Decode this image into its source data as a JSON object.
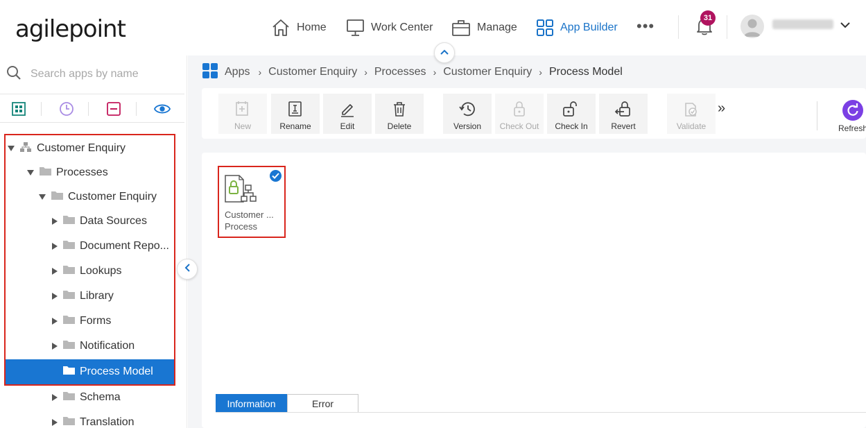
{
  "header": {
    "logo": "agilepoint",
    "nav": [
      {
        "label": "Home",
        "icon": "home-icon"
      },
      {
        "label": "Work Center",
        "icon": "monitor-icon"
      },
      {
        "label": "Manage",
        "icon": "briefcase-icon"
      },
      {
        "label": "App Builder",
        "icon": "app-grid-icon",
        "active": true
      }
    ],
    "more": "•••",
    "notification_count": "31"
  },
  "sidebar": {
    "search_placeholder": "Search apps by name",
    "tree": [
      {
        "label": "Customer Enquiry",
        "level": 0,
        "expanded": true,
        "icon": "sitemap-icon"
      },
      {
        "label": "Processes",
        "level": 1,
        "expanded": true,
        "icon": "folder-icon"
      },
      {
        "label": "Customer Enquiry",
        "level": 2,
        "expanded": true,
        "icon": "folder-icon"
      },
      {
        "label": "Data Sources",
        "level": 3,
        "expanded": false,
        "icon": "folder-icon"
      },
      {
        "label": "Document Repo...",
        "level": 3,
        "expanded": false,
        "icon": "folder-icon"
      },
      {
        "label": "Lookups",
        "level": 3,
        "expanded": false,
        "icon": "folder-icon"
      },
      {
        "label": "Library",
        "level": 3,
        "expanded": false,
        "icon": "folder-icon"
      },
      {
        "label": "Forms",
        "level": 3,
        "expanded": false,
        "icon": "folder-icon"
      },
      {
        "label": "Notification",
        "level": 3,
        "expanded": false,
        "icon": "folder-icon"
      },
      {
        "label": "Process Model",
        "level": 3,
        "selected": true,
        "icon": "folder-icon"
      },
      {
        "label": "Schema",
        "level": 3,
        "expanded": false,
        "icon": "folder-icon"
      },
      {
        "label": "Translation",
        "level": 3,
        "expanded": false,
        "icon": "folder-icon"
      }
    ]
  },
  "breadcrumb": {
    "items": [
      "Apps",
      "Customer Enquiry",
      "Processes",
      "Customer Enquiry",
      "Process Model"
    ],
    "separator": "›"
  },
  "toolbar": {
    "new": "New",
    "rename": "Rename",
    "edit": "Edit",
    "delete": "Delete",
    "version": "Version",
    "check_out": "Check Out",
    "check_in": "Check In",
    "revert": "Revert",
    "validate": "Validate",
    "more": "»",
    "refresh": "Refresh"
  },
  "content": {
    "card": {
      "name": "Customer ...",
      "type": "Process"
    },
    "tabs": [
      "Information",
      "Error"
    ]
  },
  "colors": {
    "accent": "#1976d2",
    "highlight_border": "#d9251c",
    "badge": "#b0135f",
    "refresh": "#7b3fe4",
    "lock_green": "#7cb342"
  }
}
